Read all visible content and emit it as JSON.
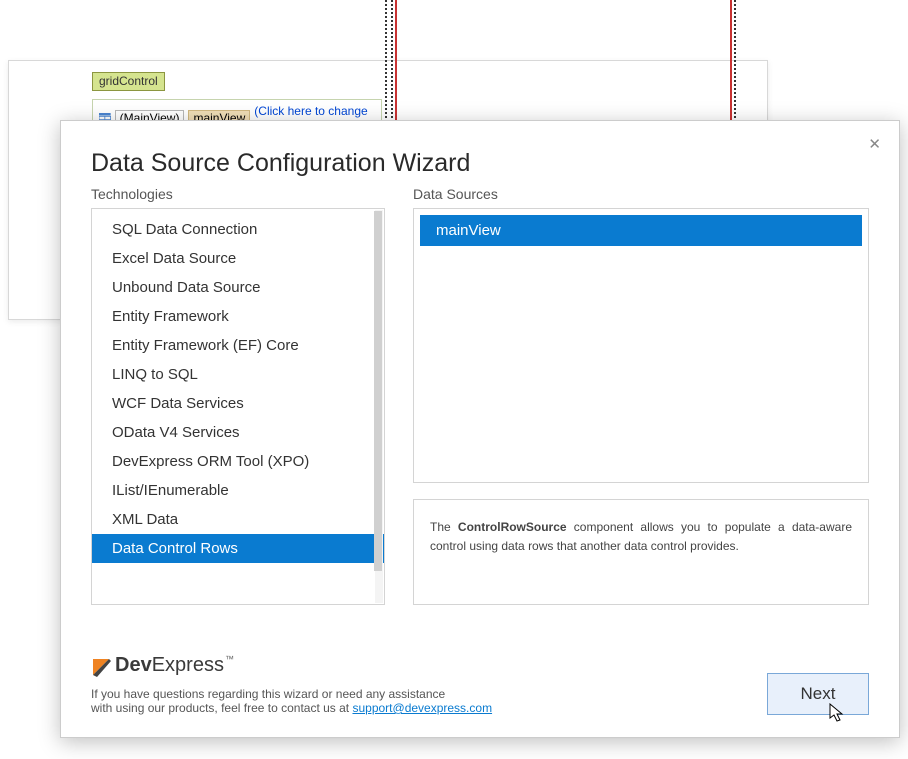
{
  "designer": {
    "gridControlLabel": "gridControl",
    "mainViewParent": "(MainView)",
    "mainViewLabel": "mainView",
    "changeViewLink": "(Click here to change view)"
  },
  "wizard": {
    "title": "Data Source Configuration Wizard",
    "technologiesLabel": "Technologies",
    "dataSourcesLabel": "Data Sources",
    "technologies": [
      "SQL Data Connection",
      "Excel Data Source",
      "Unbound Data Source",
      "Entity Framework",
      "Entity Framework (EF) Core",
      "LINQ to SQL",
      "WCF Data Services",
      "OData V4 Services",
      "DevExpress ORM Tool (XPO)",
      "IList/IEnumerable",
      "XML Data",
      "Data Control Rows"
    ],
    "selectedTechIndex": 11,
    "dataSources": [
      "mainView"
    ],
    "selectedDsIndex": 0,
    "description": {
      "prefix": "The ",
      "bold": "ControlRowSource",
      "suffix": " component allows you to populate a data-aware control using data rows that another data control provides."
    },
    "footer": {
      "brandDev": "Dev",
      "brandExpress": "Express",
      "tm": "™",
      "line1": "If you have questions regarding this wizard or need any assistance",
      "line2a": "with using our products, feel free to contact us at ",
      "supportEmail": "support@devexpress.com"
    },
    "nextButton": "Next"
  }
}
